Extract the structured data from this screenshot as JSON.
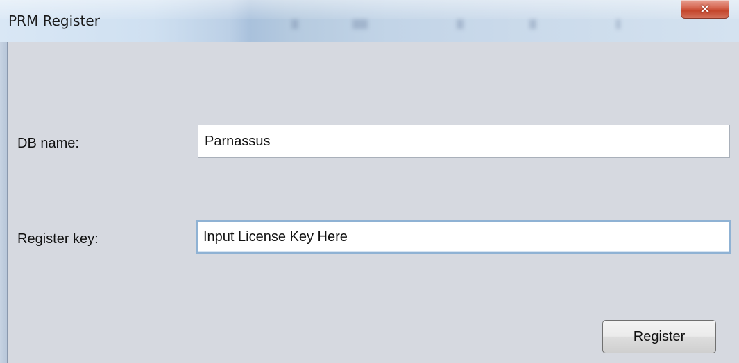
{
  "window": {
    "title": "PRM Register"
  },
  "form": {
    "db_name": {
      "label": "DB name:",
      "value": "Parnassus"
    },
    "register_key": {
      "label": "Register key:",
      "value": "Input License Key Here"
    },
    "register_button_label": "Register"
  },
  "icons": {
    "close": "close-icon"
  }
}
